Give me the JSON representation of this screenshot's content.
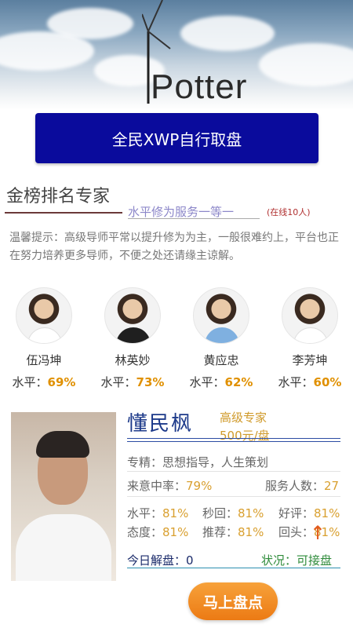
{
  "header": {
    "logo_text": "Potter"
  },
  "cta": {
    "label": "全民XWP自行取盘"
  },
  "section": {
    "title": "金榜排名专家",
    "subtitle": "水平修为服务一等一",
    "online": "(在线10人)"
  },
  "notice": "温馨提示：高级导师平常以提升修为为主，一般很难约上，平台也正在努力培养更多导师，不便之处还请缘主谅解。",
  "experts": [
    {
      "name": "伍冯坤",
      "level_label": "水平：",
      "level": "69%"
    },
    {
      "name": "林英妙",
      "level_label": "水平：",
      "level": "73%"
    },
    {
      "name": "黄应忠",
      "level_label": "水平：",
      "level": "62%"
    },
    {
      "name": "李芳坤",
      "level_label": "水平：",
      "level": "60%"
    }
  ],
  "featured": {
    "name": "懂民枫",
    "title": "高级专家",
    "price": "500元/盘",
    "specialty": "专精：思想指导，人生策划",
    "intent_label": "来意中率：",
    "intent_value": "79%",
    "served_label": "服务人数：",
    "served_value": "27",
    "stats": [
      {
        "label": "水平：",
        "value": "81%"
      },
      {
        "label": "秒回：",
        "value": "81%"
      },
      {
        "label": "好评：",
        "value": "81%"
      },
      {
        "label": "态度：",
        "value": "81%"
      },
      {
        "label": "推荐：",
        "value": "81%"
      },
      {
        "label": "回头：",
        "value": "81%"
      }
    ],
    "today": "今日解盘：0",
    "status": "状况：可接盘"
  },
  "actions": {
    "go_label": "马上盘点"
  },
  "colors": {
    "cta_bg": "#0a0b9c",
    "accent": "#e09000",
    "go_btn": "#ec7a14",
    "status": "#2e8b3a"
  },
  "icons": {
    "scroll_top": "up-arrow-icon"
  }
}
